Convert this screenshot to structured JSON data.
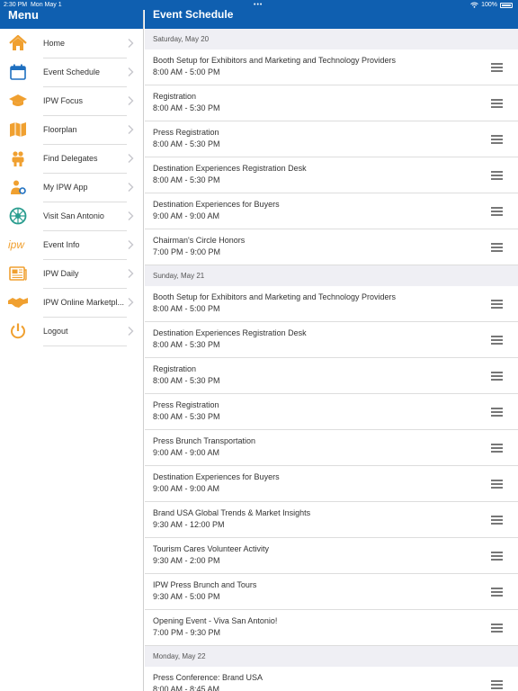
{
  "status_bar": {
    "time": "2:30 PM",
    "date": "Mon May 1",
    "battery": "100%"
  },
  "sidebar": {
    "title": "Menu",
    "items": [
      {
        "label": "Home",
        "icon": "home-icon",
        "color": "#f0a030"
      },
      {
        "label": "Event Schedule",
        "icon": "calendar-icon",
        "color": "#1e6fc0"
      },
      {
        "label": "IPW Focus",
        "icon": "graduation-cap-icon",
        "color": "#f0a030"
      },
      {
        "label": "Floorplan",
        "icon": "map-icon",
        "color": "#f0a030"
      },
      {
        "label": "Find Delegates",
        "icon": "people-icon",
        "color": "#f0a030"
      },
      {
        "label": "My IPW App",
        "icon": "person-cog-icon",
        "color": "#f0a030"
      },
      {
        "label": "Visit San Antonio",
        "icon": "emblem-icon",
        "color": "#2a9d8f"
      },
      {
        "label": "Event Info",
        "icon": "ipw-logo-icon",
        "color": "#f0a030"
      },
      {
        "label": "IPW Daily",
        "icon": "newspaper-icon",
        "color": "#f0a030"
      },
      {
        "label": "IPW Online Marketpl...",
        "icon": "handshake-icon",
        "color": "#f0a030"
      },
      {
        "label": "Logout",
        "icon": "power-icon",
        "color": "#f0a030"
      }
    ]
  },
  "main": {
    "title": "Event Schedule",
    "days": [
      {
        "date": "Saturday, May 20",
        "events": [
          {
            "title": "Booth Setup for Exhibitors and Marketing and Technology Providers",
            "time": "8:00 AM - 5:00 PM"
          },
          {
            "title": "Registration",
            "time": "8:00 AM - 5:30 PM"
          },
          {
            "title": "Press Registration",
            "time": "8:00 AM - 5:30 PM"
          },
          {
            "title": "Destination Experiences Registration Desk",
            "time": "8:00 AM - 5:30 PM"
          },
          {
            "title": "Destination Experiences for Buyers",
            "time": "9:00 AM - 9:00 AM"
          },
          {
            "title": "Chairman's Circle Honors",
            "time": "7:00 PM - 9:00 PM"
          }
        ]
      },
      {
        "date": "Sunday, May 21",
        "events": [
          {
            "title": "Booth Setup for Exhibitors and Marketing and Technology Providers",
            "time": "8:00 AM - 5:00 PM"
          },
          {
            "title": "Destination Experiences Registration Desk",
            "time": "8:00 AM - 5:30 PM"
          },
          {
            "title": "Registration",
            "time": "8:00 AM - 5:30 PM"
          },
          {
            "title": "Press Registration",
            "time": "8:00 AM - 5:30 PM"
          },
          {
            "title": "Press Brunch Transportation",
            "time": "9:00 AM - 9:00 AM"
          },
          {
            "title": "Destination Experiences for Buyers",
            "time": "9:00 AM - 9:00 AM"
          },
          {
            "title": "Brand USA Global Trends & Market Insights",
            "time": "9:30 AM - 12:00 PM"
          },
          {
            "title": "Tourism Cares Volunteer Activity",
            "time": "9:30 AM - 2:00 PM"
          },
          {
            "title": "IPW Press Brunch and Tours",
            "time": "9:30 AM - 5:00 PM"
          },
          {
            "title": "Opening Event - Viva San Antonio!",
            "time": "7:00 PM - 9:30 PM"
          }
        ]
      },
      {
        "date": "Monday, May 22",
        "events": [
          {
            "title": "Press Conference: Brand USA",
            "time": "8:00 AM - 8:45 AM"
          }
        ]
      }
    ]
  }
}
